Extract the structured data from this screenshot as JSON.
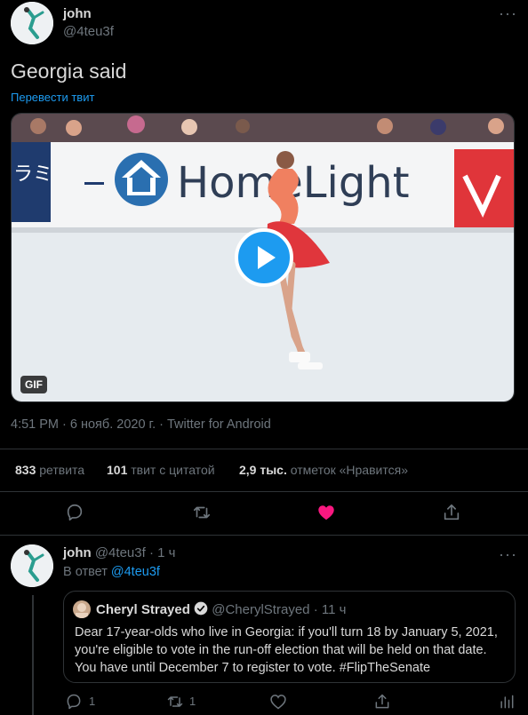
{
  "tweet": {
    "author_name": "john",
    "author_handle": "@4teu3f",
    "text": "Georgia said",
    "translate_link": "Перевести твит",
    "media_badge": "GIF",
    "media_scene_text": "HomeLight",
    "meta": "4:51 PM · 6 нояб. 2020 г. · Twitter for Android",
    "stats": {
      "retweets_count": "833",
      "retweets_label": "ретвита",
      "quotes_count": "101",
      "quotes_label": "твит с цитатой",
      "likes_count": "2,9 тыс.",
      "likes_label": "отметок «Нравится»"
    },
    "actions": [
      "reply-icon",
      "retweet-icon",
      "like-icon-filled",
      "share-icon"
    ],
    "like_color": "#f91880"
  },
  "reply": {
    "author_name": "john",
    "author_handle": "@4teu3f",
    "time": "· 1 ч",
    "reply_to_prefix": "В ответ",
    "reply_to_handle": "@4teu3f",
    "quoted": {
      "author_name": "Cheryl Strayed",
      "author_handle": "@CherylStrayed",
      "time": "· 11 ч",
      "text": "Dear 17-year-olds who live in Georgia: if you'll turn 18 by January 5, 2021, you're eligible to vote in the run-off election that will be held on that date. You have until December 7 to register to vote. #FlipTheSenate"
    },
    "reply_count": "1",
    "retweet_count": "1"
  },
  "colors": {
    "background": "#000000",
    "accent": "#1d9bf0",
    "divider": "#2f3336",
    "muted": "#6e767d"
  }
}
